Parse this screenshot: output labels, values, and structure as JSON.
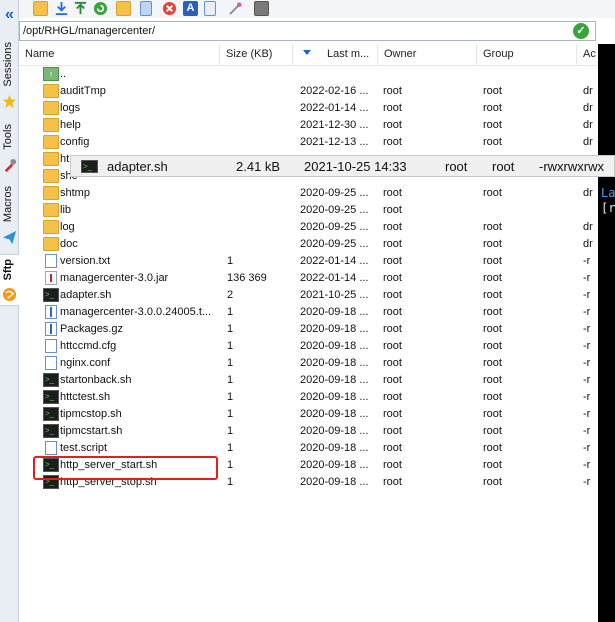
{
  "sidebar": {
    "collapse_icon": "double-chevron-left-icon",
    "tabs": [
      {
        "label": "Sessions",
        "icon": "star-icon"
      },
      {
        "label": "Tools",
        "icon": "tools-icon"
      },
      {
        "label": "Macros",
        "icon": "paper-plane-icon"
      },
      {
        "label": "Sftp",
        "icon": "globe-icon"
      }
    ]
  },
  "toolbar": {
    "icons": [
      "parent-folder-icon",
      "download-icon",
      "upload-icon",
      "refresh-icon",
      "new-folder-icon",
      "new-file-icon",
      "delete-icon",
      "text-edit-icon",
      "file-properties-icon",
      "magic-wand-icon",
      "terminal-icon"
    ]
  },
  "path": {
    "value": "/opt/RHGL/managercenter/",
    "ok_icon": "checkmark-icon"
  },
  "columns": {
    "name": "Name",
    "size": "Size (KB)",
    "modified": "Last m...",
    "owner": "Owner",
    "group": "Group",
    "access": "Ac"
  },
  "files": [
    {
      "name": "..",
      "type": "up",
      "size": "",
      "date": "",
      "owner": "",
      "group": "",
      "perm": ""
    },
    {
      "name": "auditTmp",
      "type": "folder",
      "size": "",
      "date": "2022-02-16 ...",
      "owner": "root",
      "group": "root",
      "perm": "dr"
    },
    {
      "name": "logs",
      "type": "folder",
      "size": "",
      "date": "2022-01-14 ...",
      "owner": "root",
      "group": "root",
      "perm": "dr"
    },
    {
      "name": "help",
      "type": "folder",
      "size": "",
      "date": "2021-12-30 ...",
      "owner": "root",
      "group": "root",
      "perm": "dr"
    },
    {
      "name": "config",
      "type": "folder",
      "size": "",
      "date": "2021-12-13 ...",
      "owner": "root",
      "group": "root",
      "perm": "dr"
    },
    {
      "name": "ht",
      "type": "folder",
      "size": "",
      "date": "",
      "owner": "",
      "group": "",
      "perm": ""
    },
    {
      "name": "she",
      "type": "folder",
      "size": "",
      "date": "",
      "owner": "",
      "group": "",
      "perm": ""
    },
    {
      "name": "shtmp",
      "type": "folder",
      "size": "",
      "date": "2020-09-25 ...",
      "owner": "root",
      "group": "root",
      "perm": "dr"
    },
    {
      "name": "lib",
      "type": "folder",
      "size": "",
      "date": "2020-09-25 ...",
      "owner": "root",
      "group": "",
      "perm": ""
    },
    {
      "name": "log",
      "type": "folder",
      "size": "",
      "date": "2020-09-25 ...",
      "owner": "root",
      "group": "root",
      "perm": "dr"
    },
    {
      "name": "doc",
      "type": "folder",
      "size": "",
      "date": "2020-09-25 ...",
      "owner": "root",
      "group": "root",
      "perm": "dr"
    },
    {
      "name": "version.txt",
      "type": "doc",
      "size": "1",
      "date": "2022-01-14 ...",
      "owner": "root",
      "group": "root",
      "perm": "-r"
    },
    {
      "name": "managercenter-3.0.jar",
      "type": "jar",
      "size": "136 369",
      "date": "2022-01-14 ...",
      "owner": "root",
      "group": "root",
      "perm": "-r"
    },
    {
      "name": "adapter.sh",
      "type": "term",
      "size": "2",
      "date": "2021-10-25 ...",
      "owner": "root",
      "group": "root",
      "perm": "-r"
    },
    {
      "name": "managercenter-3.0.0.24005.t...",
      "type": "tgz",
      "size": "1",
      "date": "2020-09-18 ...",
      "owner": "root",
      "group": "root",
      "perm": "-r"
    },
    {
      "name": "Packages.gz",
      "type": "tgz",
      "size": "1",
      "date": "2020-09-18 ...",
      "owner": "root",
      "group": "root",
      "perm": "-r"
    },
    {
      "name": "httccmd.cfg",
      "type": "doc",
      "size": "1",
      "date": "2020-09-18 ...",
      "owner": "root",
      "group": "root",
      "perm": "-r"
    },
    {
      "name": "nginx.conf",
      "type": "doc",
      "size": "1",
      "date": "2020-09-18 ...",
      "owner": "root",
      "group": "root",
      "perm": "-r"
    },
    {
      "name": "startonback.sh",
      "type": "term",
      "size": "1",
      "date": "2020-09-18 ...",
      "owner": "root",
      "group": "root",
      "perm": "-r"
    },
    {
      "name": "httctest.sh",
      "type": "term",
      "size": "1",
      "date": "2020-09-18 ...",
      "owner": "root",
      "group": "root",
      "perm": "-r"
    },
    {
      "name": "tipmcstop.sh",
      "type": "term",
      "size": "1",
      "date": "2020-09-18 ...",
      "owner": "root",
      "group": "root",
      "perm": "-r"
    },
    {
      "name": "tipmcstart.sh",
      "type": "term",
      "size": "1",
      "date": "2020-09-18 ...",
      "owner": "root",
      "group": "root",
      "perm": "-r"
    },
    {
      "name": "test.script",
      "type": "doc",
      "size": "1",
      "date": "2020-09-18 ...",
      "owner": "root",
      "group": "root",
      "perm": "-r"
    },
    {
      "name": "http_server_start.sh",
      "type": "term",
      "size": "1",
      "date": "2020-09-18 ...",
      "owner": "root",
      "group": "root",
      "perm": "-r"
    },
    {
      "name": "http_server_stop.sh",
      "type": "term",
      "size": "1",
      "date": "2020-09-18 ...",
      "owner": "root",
      "group": "root",
      "perm": "-r"
    }
  ],
  "drag_tooltip": {
    "name": "adapter.sh",
    "size": "2.41 kB",
    "date": "2021-10-25 14:33",
    "owner": "root",
    "group": "root",
    "perm": "-rwxrwxrwx"
  },
  "terminal": {
    "lines": [
      {
        "text": "La",
        "color": "#4aa3ff"
      },
      {
        "text": "[r",
        "color": "#e8e8e8"
      }
    ]
  },
  "colors": {
    "highlight": "#e0201f",
    "accent": "#1b64c8",
    "folder": "#f6c14a"
  }
}
